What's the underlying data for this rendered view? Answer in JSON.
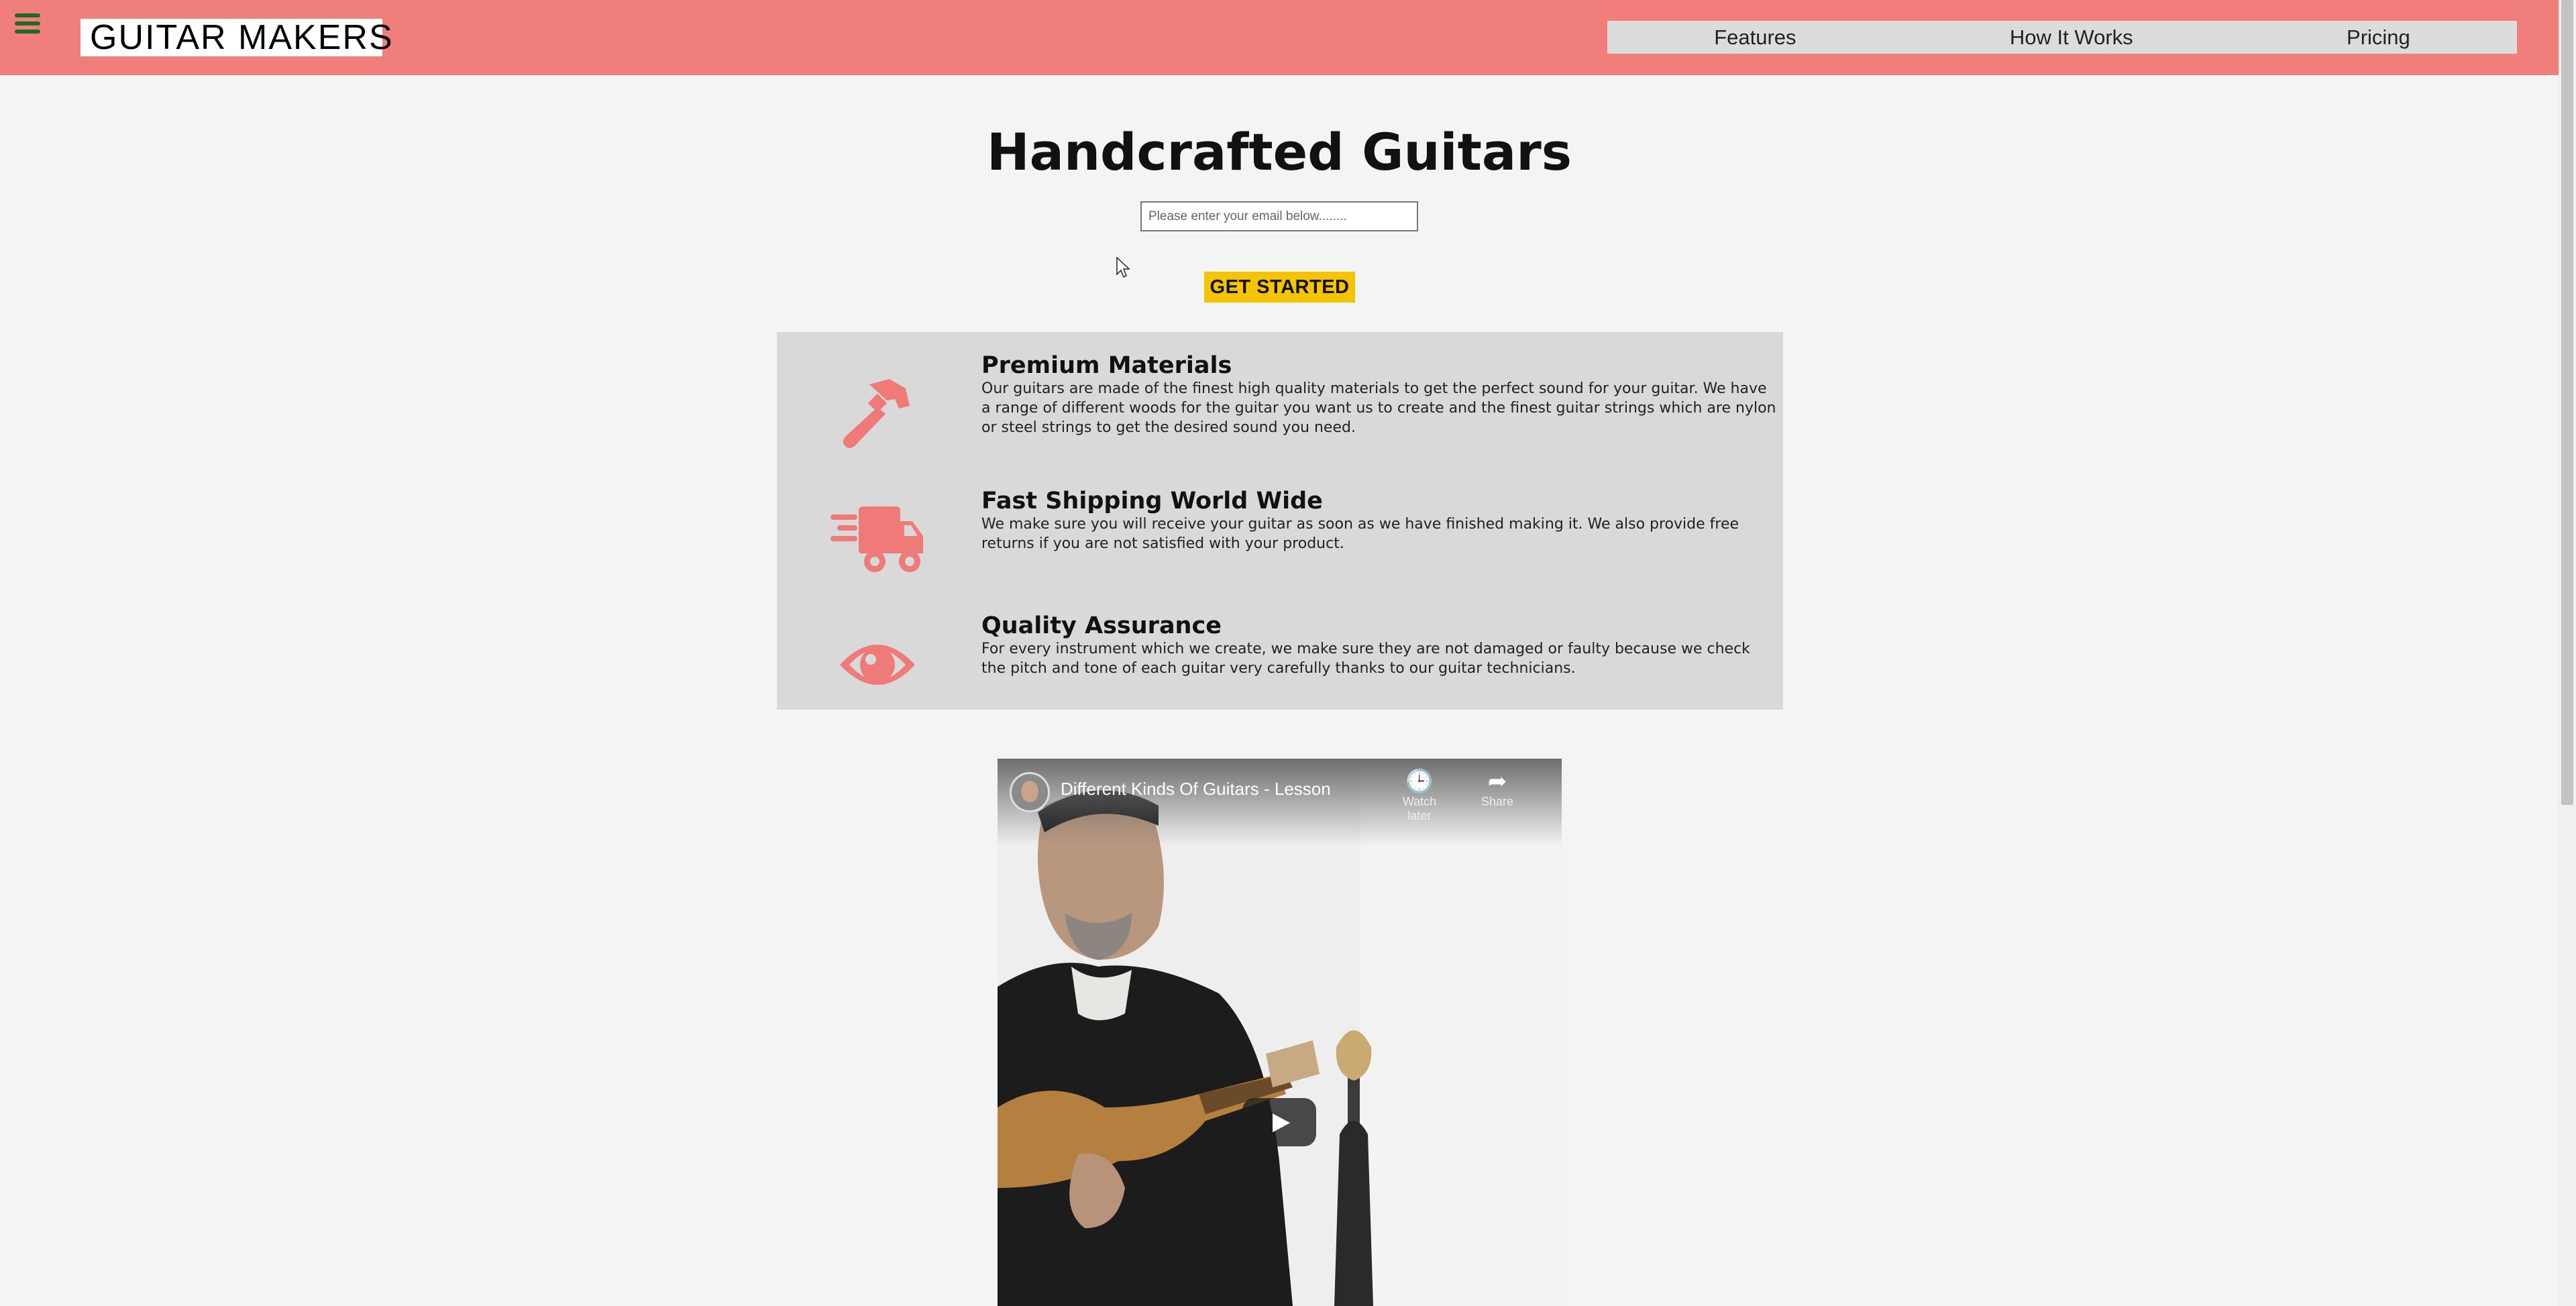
{
  "header": {
    "logo": "GUITAR MAKERS",
    "menu_icon": "hamburger-icon",
    "nav": [
      "Features",
      "How It Works",
      "Pricing"
    ],
    "background": "#f07f7c"
  },
  "hero": {
    "title": "Handcrafted Guitars",
    "email_placeholder": "Please enter your email below........",
    "cta_label": "GET STARTED",
    "cta_color": "#f5c400"
  },
  "features": [
    {
      "icon": "hammer-icon",
      "title": "Premium Materials",
      "text": "Our guitars are made of the finest high quality materials to get the perfect sound for your guitar. We have a range of different woods for the guitar you want us to create and the finest guitar strings which are nylon or steel strings to get the desired sound you need."
    },
    {
      "icon": "shipping-truck-icon",
      "title": "Fast Shipping World Wide",
      "text": "We make sure you will receive your guitar as soon as we have finished making it. We also provide free returns if you are not satisfied with your product."
    },
    {
      "icon": "eye-icon",
      "title": "Quality Assurance",
      "text": "For every instrument which we create, we make sure they are not damaged or faulty because we check the pitch and tone of each guitar very carefully thanks to our guitar technicians."
    }
  ],
  "video": {
    "title": "Different Kinds Of Guitars - Lesson",
    "watch_later": "Watch later",
    "share": "Share",
    "icons": [
      "clock-icon",
      "share-arrow-icon",
      "play-icon"
    ]
  },
  "accent_color": "#ee7b78"
}
